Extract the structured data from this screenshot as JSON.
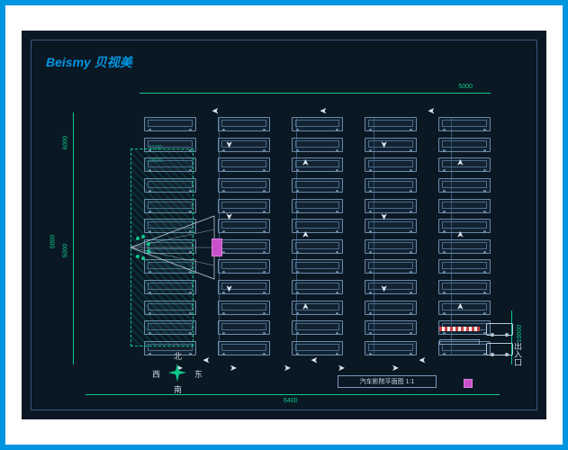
{
  "logo": "Beismy 贝视美",
  "title": "汽车影院平面图 1:1",
  "dimensions": {
    "width_total": "6400",
    "height_total": "5000",
    "top_margin": "5000",
    "left_seg_1": "6000",
    "left_seg_2": "5000",
    "slot_w": "1100",
    "slot_d": "1850",
    "exit_w": "10000"
  },
  "compass": {
    "n": "北",
    "s": "南",
    "e": "东",
    "w": "西"
  },
  "exit_label": "出入口",
  "parking": {
    "columns": 5,
    "rows_per_column": 12
  },
  "screen_marker": "◼",
  "arrows_right": "→",
  "arrows_set": [
    "→",
    "→",
    "→",
    "→"
  ]
}
